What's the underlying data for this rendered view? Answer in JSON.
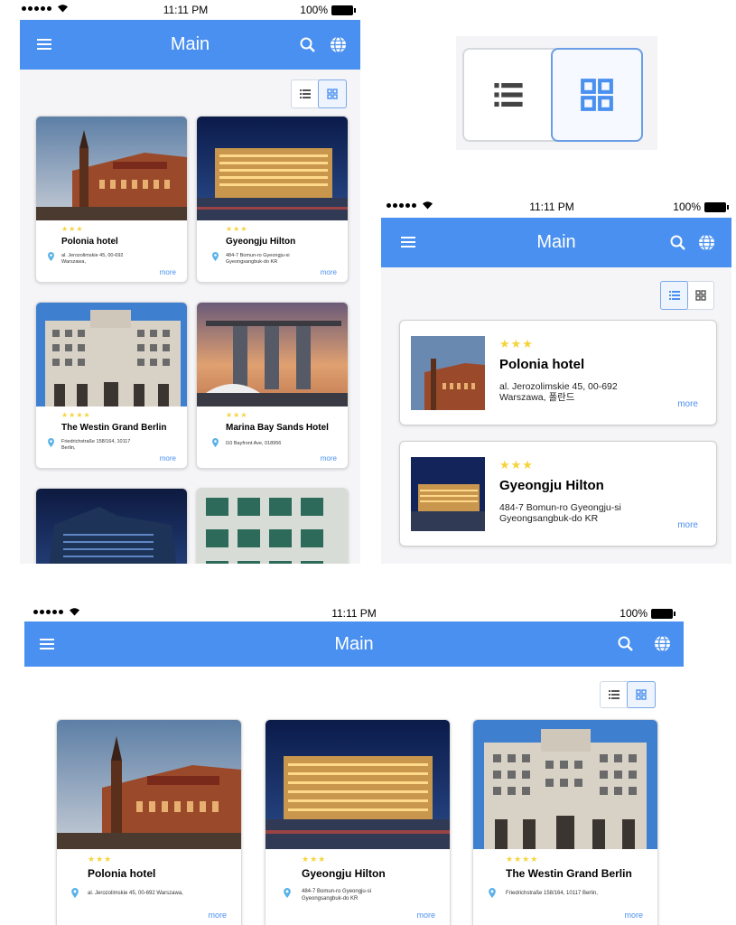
{
  "status": {
    "time": "11:11 PM",
    "battery": "100%"
  },
  "appbar": {
    "title": "Main"
  },
  "hotels": [
    {
      "name": "Polonia hotel",
      "stars": "★★★",
      "address": "al. Jerozolimskie 45, 00-692 Warszawa,",
      "address_line1": "al. Jerozolimskie 45, 00-692",
      "address_line2": "Warszawa,",
      "more": "more"
    },
    {
      "name": "Gyeongju Hilton",
      "stars": "★★★",
      "address_line1": "484-7 Bomun-ro Gyeongju-si",
      "address_line2": "Gyeongsangbuk-do KR",
      "more": "more"
    },
    {
      "name": "The Westin Grand Berlin",
      "stars": "★★★★",
      "address": "Friedrichstraße 158/164, 10117 Berlin,",
      "address_line1": "Friedrichstraße 158/164, 10117",
      "address_line2": "Berlin,",
      "more": "more"
    },
    {
      "name": "Marina Bay Sands Hotel",
      "stars": "★★★",
      "address_line1": "l10 Bayfront Ave, 018956",
      "more": "more"
    }
  ],
  "list_hotels": [
    {
      "name": "Polonia hotel",
      "stars": "★★★",
      "address_line1": "al. Jerozolimskie 45, 00-692",
      "address_line2": "Warszawa, 폴란드",
      "more": "more"
    },
    {
      "name": "Gyeongju Hilton",
      "stars": "★★★",
      "address_line1": "484-7 Bomun-ro Gyeongju-si",
      "address_line2": "Gyeongsangbuk-do KR",
      "more": "more"
    }
  ],
  "colors": {
    "primary": "#4a90f0",
    "star": "#f5d33c",
    "background": "#f5f5f7"
  },
  "icons": [
    "menu-icon",
    "search-icon",
    "globe-icon",
    "list-view-icon",
    "grid-view-icon",
    "location-pin-icon",
    "wifi-icon",
    "battery-icon"
  ]
}
